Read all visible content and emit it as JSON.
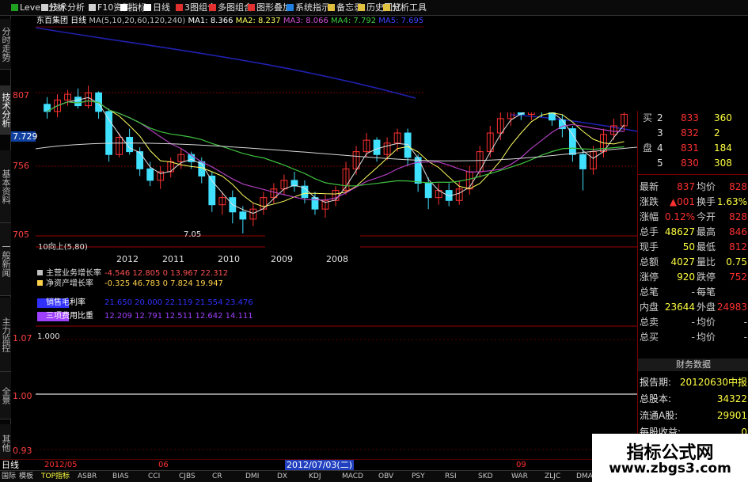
{
  "toolbar": {
    "items": [
      "Level2分析",
      "技术分析",
      "F10资料",
      "指标",
      "日线",
      "3图组合",
      "多图组合",
      "图形叠加",
      "系统指示",
      "备忘录",
      "历史回忆",
      "分析工具"
    ]
  },
  "left_tabs": [
    "分时走势",
    "技术分析",
    "基本资料",
    "一般新闻",
    "主力监控",
    "全景",
    "其他"
  ],
  "stock_info": {
    "name": "东百集团 日线",
    "ma_params": "MA(5,10,20,60,120,240)",
    "ma1": "MA1: 8.366",
    "ma2": "MA2: 8.237",
    "ma3": "MA3: 8.066",
    "ma4": "MA4: 7.792",
    "ma5": "MA5: 7.695"
  },
  "y_axis": {
    "top": "807",
    "current": "7.729",
    "mid": "756",
    "low": "705",
    "marker_low": "7.05",
    "sub_top": "1.07",
    "sub_mid": "1.00",
    "sub_low": "0.93"
  },
  "lower_panel": {
    "title": "10向上(5,80)",
    "years": [
      "2012",
      "2011",
      "2010",
      "2009",
      "2008"
    ],
    "rows": [
      {
        "label": "主营业务增长率",
        "values": "-4.546 12.805 0 13.967 22.312",
        "color": "#c0c0c0"
      },
      {
        "label": "净资产增长率",
        "values": "-0.325 46.783 0 7.824 19.947",
        "color": "#ffd24a"
      },
      {
        "label": "销售毛利率",
        "values": "21.650 20.000 22.119 21.554 23.476",
        "color": "#3030ff"
      },
      {
        "label": "三项费用比重",
        "values": "12.209 12.791 12.511 12.642 14.111",
        "color": "#a040ff"
      }
    ],
    "indicator_value": "1.000"
  },
  "right_panel": {
    "bids": [
      {
        "label": "买",
        "level": "2",
        "price": "833",
        "vol": "360"
      },
      {
        "label": "",
        "level": "3",
        "price": "832",
        "vol": "2"
      },
      {
        "label": "盘",
        "level": "4",
        "price": "831",
        "vol": "184"
      },
      {
        "label": "",
        "level": "5",
        "price": "830",
        "vol": "308"
      }
    ],
    "quote": [
      {
        "l1": "最新",
        "v1": "837",
        "l2": "均价",
        "v2": "828"
      },
      {
        "l1": "涨跌",
        "v1": "▲001",
        "l2": "换手",
        "v2": "1.63%"
      },
      {
        "l1": "涨幅",
        "v1": "0.12%",
        "l2": "今开",
        "v2": "828"
      },
      {
        "l1": "总手",
        "v1": "48627",
        "l2": "最高",
        "v2": "846"
      },
      {
        "l1": "现手",
        "v1": "50",
        "l2": "最低",
        "v2": "812"
      },
      {
        "l1": "总额",
        "v1": "4027",
        "l2": "量比",
        "v2": "0.75"
      },
      {
        "l1": "涨停",
        "v1": "920",
        "l2": "跌停",
        "v2": "752"
      },
      {
        "l1": "总笔",
        "v1": "-",
        "l2": "每笔",
        "v2": ""
      },
      {
        "l1": "内盘",
        "v1": "23644",
        "l2": "外盘",
        "v2": "24983"
      },
      {
        "l1": "总卖",
        "v1": "-",
        "l2": "均价",
        "v2": "-"
      },
      {
        "l1": "总买",
        "v1": "-",
        "l2": "均价",
        "v2": "-"
      }
    ],
    "fin_title": "财务数据",
    "fin": [
      {
        "label": "报告期:",
        "value": "20120630中报"
      },
      {
        "label": "总股本:",
        "value": "34322"
      },
      {
        "label": "流通A股:",
        "value": "29901"
      },
      {
        "label": "每股收益:",
        "value": "0"
      }
    ]
  },
  "status_bar": {
    "mode": "日线",
    "date_left": "2012/05",
    "month_mid": "06",
    "date_sel": "2012/07/03(二)",
    "month_right": "09"
  },
  "indicator_bar": [
    "国际",
    "模板",
    "TOP指标",
    "ASBR",
    "BIAS",
    "CCI",
    "CJBS",
    "CR",
    "DMI",
    "DX",
    "KDJ",
    "MACD",
    "OBV",
    "PSY",
    "RSI",
    "SKD",
    "WAR",
    "ZLJC",
    "DMA"
  ],
  "watermark": {
    "title": "指标公式网",
    "url": "www.zbgs3.com"
  },
  "colors": {
    "up": "#ff3030",
    "down": "#40e0ff",
    "ma_white": "#e0e0e0",
    "ma_purple": "#b040c0",
    "ma_green": "#40c040",
    "ma_blue": "#3030c0"
  },
  "chart_data": {
    "type": "candlestick",
    "series": [
      {
        "name": "MA1",
        "color": "#e0e0e0"
      },
      {
        "name": "MA2",
        "color": "#ffff60"
      },
      {
        "name": "MA3",
        "color": "#b040c0"
      },
      {
        "name": "MA4",
        "color": "#40c040"
      },
      {
        "name": "MA5",
        "color": "#3030c0"
      }
    ],
    "ylim": [
      7.05,
      8.07
    ],
    "candles": [
      {
        "o": 7.95,
        "c": 7.9,
        "h": 8.0,
        "l": 7.85
      },
      {
        "o": 7.9,
        "c": 7.98,
        "h": 8.02,
        "l": 7.86
      },
      {
        "o": 7.98,
        "c": 8.02,
        "h": 8.05,
        "l": 7.94
      },
      {
        "o": 8.0,
        "c": 7.94,
        "h": 8.06,
        "l": 7.92
      },
      {
        "o": 7.94,
        "c": 8.03,
        "h": 8.08,
        "l": 7.92
      },
      {
        "o": 8.03,
        "c": 7.9,
        "h": 8.04,
        "l": 7.85
      },
      {
        "o": 7.9,
        "c": 7.6,
        "h": 7.92,
        "l": 7.55
      },
      {
        "o": 7.6,
        "c": 7.72,
        "h": 7.75,
        "l": 7.58
      },
      {
        "o": 7.72,
        "c": 7.62,
        "h": 7.78,
        "l": 7.6
      },
      {
        "o": 7.62,
        "c": 7.5,
        "h": 7.65,
        "l": 7.45
      },
      {
        "o": 7.5,
        "c": 7.42,
        "h": 7.55,
        "l": 7.38
      },
      {
        "o": 7.42,
        "c": 7.48,
        "h": 7.52,
        "l": 7.36
      },
      {
        "o": 7.48,
        "c": 7.55,
        "h": 7.58,
        "l": 7.44
      },
      {
        "o": 7.55,
        "c": 7.6,
        "h": 7.64,
        "l": 7.5
      },
      {
        "o": 7.6,
        "c": 7.55,
        "h": 7.62,
        "l": 7.5
      },
      {
        "o": 7.55,
        "c": 7.45,
        "h": 7.58,
        "l": 7.4
      },
      {
        "o": 7.45,
        "c": 7.25,
        "h": 7.48,
        "l": 7.2
      },
      {
        "o": 7.25,
        "c": 7.3,
        "h": 7.34,
        "l": 7.18
      },
      {
        "o": 7.3,
        "c": 7.2,
        "h": 7.35,
        "l": 7.12
      },
      {
        "o": 7.2,
        "c": 7.15,
        "h": 7.24,
        "l": 7.05
      },
      {
        "o": 7.15,
        "c": 7.22,
        "h": 7.26,
        "l": 7.1
      },
      {
        "o": 7.22,
        "c": 7.3,
        "h": 7.34,
        "l": 7.18
      },
      {
        "o": 7.3,
        "c": 7.36,
        "h": 7.4,
        "l": 7.26
      },
      {
        "o": 7.36,
        "c": 7.42,
        "h": 7.46,
        "l": 7.32
      },
      {
        "o": 7.42,
        "c": 7.38,
        "h": 7.48,
        "l": 7.34
      },
      {
        "o": 7.38,
        "c": 7.3,
        "h": 7.42,
        "l": 7.26
      },
      {
        "o": 7.3,
        "c": 7.22,
        "h": 7.34,
        "l": 7.18
      },
      {
        "o": 7.22,
        "c": 7.28,
        "h": 7.32,
        "l": 7.16
      },
      {
        "o": 7.28,
        "c": 7.35,
        "h": 7.38,
        "l": 7.24
      },
      {
        "o": 7.35,
        "c": 7.5,
        "h": 7.55,
        "l": 7.32
      },
      {
        "o": 7.5,
        "c": 7.62,
        "h": 7.66,
        "l": 7.46
      },
      {
        "o": 7.62,
        "c": 7.7,
        "h": 7.75,
        "l": 7.58
      },
      {
        "o": 7.7,
        "c": 7.6,
        "h": 7.72,
        "l": 7.55
      },
      {
        "o": 7.6,
        "c": 7.68,
        "h": 7.72,
        "l": 7.56
      },
      {
        "o": 7.68,
        "c": 7.75,
        "h": 7.78,
        "l": 7.62
      },
      {
        "o": 7.75,
        "c": 7.58,
        "h": 7.78,
        "l": 7.52
      },
      {
        "o": 7.58,
        "c": 7.4,
        "h": 7.6,
        "l": 7.34
      },
      {
        "o": 7.4,
        "c": 7.3,
        "h": 7.44,
        "l": 7.22
      },
      {
        "o": 7.3,
        "c": 7.35,
        "h": 7.4,
        "l": 7.25
      },
      {
        "o": 7.35,
        "c": 7.28,
        "h": 7.4,
        "l": 7.24
      },
      {
        "o": 7.28,
        "c": 7.36,
        "h": 7.42,
        "l": 7.25
      },
      {
        "o": 7.36,
        "c": 7.48,
        "h": 7.52,
        "l": 7.32
      },
      {
        "o": 7.48,
        "c": 7.62,
        "h": 7.66,
        "l": 7.44
      },
      {
        "o": 7.62,
        "c": 7.75,
        "h": 7.8,
        "l": 7.58
      },
      {
        "o": 7.75,
        "c": 7.85,
        "h": 7.9,
        "l": 7.7
      },
      {
        "o": 7.85,
        "c": 7.92,
        "h": 7.96,
        "l": 7.8
      },
      {
        "o": 7.92,
        "c": 7.88,
        "h": 7.98,
        "l": 7.84
      },
      {
        "o": 7.88,
        "c": 7.95,
        "h": 8.0,
        "l": 7.84
      },
      {
        "o": 7.95,
        "c": 7.9,
        "h": 7.98,
        "l": 7.86
      },
      {
        "o": 7.9,
        "c": 7.84,
        "h": 7.94,
        "l": 7.8
      },
      {
        "o": 7.84,
        "c": 7.78,
        "h": 7.88,
        "l": 7.72
      },
      {
        "o": 7.78,
        "c": 7.6,
        "h": 7.8,
        "l": 7.55
      },
      {
        "o": 7.6,
        "c": 7.5,
        "h": 7.64,
        "l": 7.35
      },
      {
        "o": 7.5,
        "c": 7.62,
        "h": 7.66,
        "l": 7.46
      },
      {
        "o": 7.62,
        "c": 7.74,
        "h": 7.78,
        "l": 7.58
      },
      {
        "o": 7.74,
        "c": 7.8,
        "h": 7.85,
        "l": 7.7
      },
      {
        "o": 7.8,
        "c": 7.88,
        "h": 7.92,
        "l": 7.76
      }
    ]
  }
}
